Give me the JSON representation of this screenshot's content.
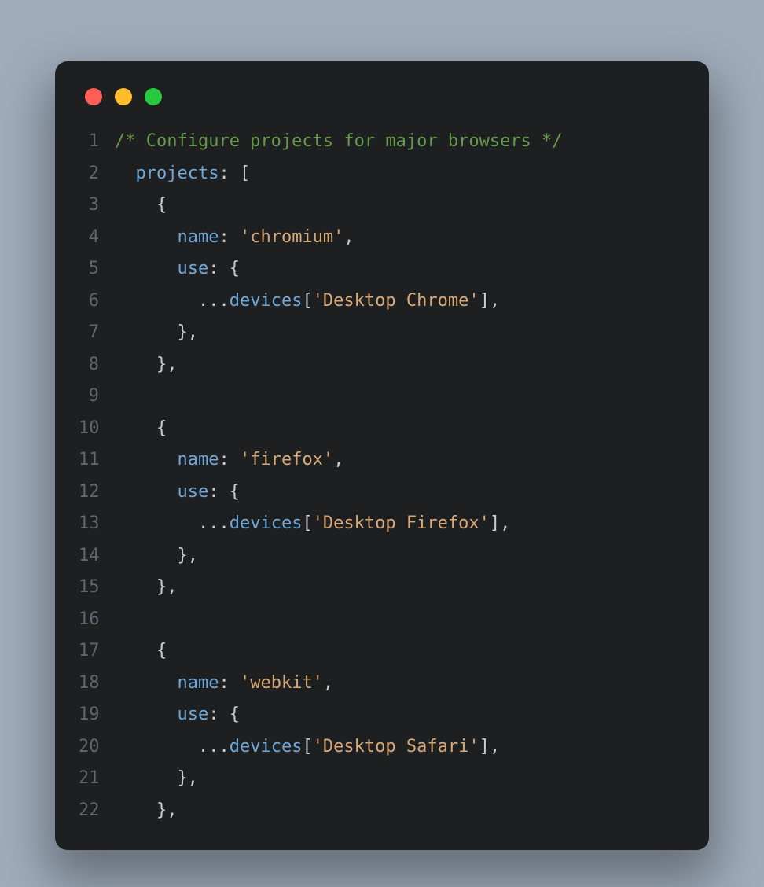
{
  "window": {
    "traffic_lights": {
      "red": "#ff5f56",
      "yellow": "#ffbd2e",
      "green": "#27c93f"
    }
  },
  "code": {
    "lines": [
      {
        "n": "1",
        "indent": 0,
        "tokens": [
          {
            "t": "/* Configure projects for major browsers */",
            "c": "comment"
          }
        ]
      },
      {
        "n": "2",
        "indent": 1,
        "tokens": [
          {
            "t": "projects",
            "c": "key"
          },
          {
            "t": ": [",
            "c": "punc"
          }
        ]
      },
      {
        "n": "3",
        "indent": 2,
        "tokens": [
          {
            "t": "{",
            "c": "punc"
          }
        ]
      },
      {
        "n": "4",
        "indent": 3,
        "tokens": [
          {
            "t": "name",
            "c": "key"
          },
          {
            "t": ": ",
            "c": "punc"
          },
          {
            "t": "'chromium'",
            "c": "str"
          },
          {
            "t": ",",
            "c": "punc"
          }
        ]
      },
      {
        "n": "5",
        "indent": 3,
        "tokens": [
          {
            "t": "use",
            "c": "key"
          },
          {
            "t": ": {",
            "c": "punc"
          }
        ]
      },
      {
        "n": "6",
        "indent": 4,
        "tokens": [
          {
            "t": "...",
            "c": "punc"
          },
          {
            "t": "devices",
            "c": "ident"
          },
          {
            "t": "[",
            "c": "punc"
          },
          {
            "t": "'Desktop Chrome'",
            "c": "str"
          },
          {
            "t": "],",
            "c": "punc"
          }
        ]
      },
      {
        "n": "7",
        "indent": 3,
        "tokens": [
          {
            "t": "},",
            "c": "punc"
          }
        ]
      },
      {
        "n": "8",
        "indent": 2,
        "tokens": [
          {
            "t": "},",
            "c": "punc"
          }
        ]
      },
      {
        "n": "9",
        "indent": 0,
        "tokens": []
      },
      {
        "n": "10",
        "indent": 2,
        "tokens": [
          {
            "t": "{",
            "c": "punc"
          }
        ]
      },
      {
        "n": "11",
        "indent": 3,
        "tokens": [
          {
            "t": "name",
            "c": "key"
          },
          {
            "t": ": ",
            "c": "punc"
          },
          {
            "t": "'firefox'",
            "c": "str"
          },
          {
            "t": ",",
            "c": "punc"
          }
        ]
      },
      {
        "n": "12",
        "indent": 3,
        "tokens": [
          {
            "t": "use",
            "c": "key"
          },
          {
            "t": ": {",
            "c": "punc"
          }
        ]
      },
      {
        "n": "13",
        "indent": 4,
        "tokens": [
          {
            "t": "...",
            "c": "punc"
          },
          {
            "t": "devices",
            "c": "ident"
          },
          {
            "t": "[",
            "c": "punc"
          },
          {
            "t": "'Desktop Firefox'",
            "c": "str"
          },
          {
            "t": "],",
            "c": "punc"
          }
        ]
      },
      {
        "n": "14",
        "indent": 3,
        "tokens": [
          {
            "t": "},",
            "c": "punc"
          }
        ]
      },
      {
        "n": "15",
        "indent": 2,
        "tokens": [
          {
            "t": "},",
            "c": "punc"
          }
        ]
      },
      {
        "n": "16",
        "indent": 0,
        "tokens": []
      },
      {
        "n": "17",
        "indent": 2,
        "tokens": [
          {
            "t": "{",
            "c": "punc"
          }
        ]
      },
      {
        "n": "18",
        "indent": 3,
        "tokens": [
          {
            "t": "name",
            "c": "key"
          },
          {
            "t": ": ",
            "c": "punc"
          },
          {
            "t": "'webkit'",
            "c": "str"
          },
          {
            "t": ",",
            "c": "punc"
          }
        ]
      },
      {
        "n": "19",
        "indent": 3,
        "tokens": [
          {
            "t": "use",
            "c": "key"
          },
          {
            "t": ": {",
            "c": "punc"
          }
        ]
      },
      {
        "n": "20",
        "indent": 4,
        "tokens": [
          {
            "t": "...",
            "c": "punc"
          },
          {
            "t": "devices",
            "c": "ident"
          },
          {
            "t": "[",
            "c": "punc"
          },
          {
            "t": "'Desktop Safari'",
            "c": "str"
          },
          {
            "t": "],",
            "c": "punc"
          }
        ]
      },
      {
        "n": "21",
        "indent": 3,
        "tokens": [
          {
            "t": "},",
            "c": "punc"
          }
        ]
      },
      {
        "n": "22",
        "indent": 2,
        "tokens": [
          {
            "t": "},",
            "c": "punc"
          }
        ]
      }
    ]
  }
}
